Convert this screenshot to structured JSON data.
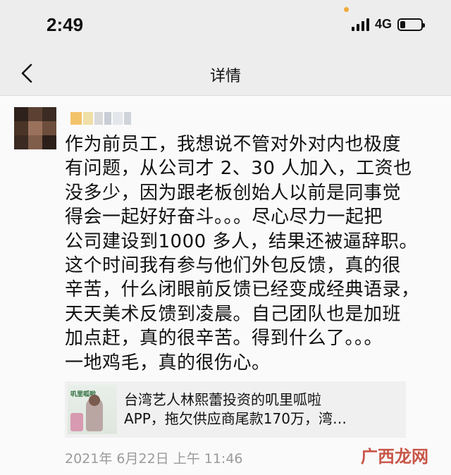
{
  "status_bar": {
    "time": "2:49",
    "network": "4G",
    "battery_level": 0.25
  },
  "nav": {
    "title": "详情",
    "back_icon": "chevron-left-icon"
  },
  "comment": {
    "lines": [
      "作为前员工，我想说不管对外对内也极度",
      "有问题，从公司才 2、30 人加入，工资也",
      "没多少，因为跟老板创始人以前是同事觉",
      "得会一起好好奋斗。。。尽心尽力一起把",
      "公司建设到1000 多人，结果还被逼辞职。",
      "这个时间我有参与他们外包反馈，真的很",
      "辛苦，什么闭眼前反馈已经变成经典语录，",
      "天天美术反馈到凌晨。自己团队也是加班",
      "加点赶，真的很辛苦。得到什么了。。。",
      "一地鸡毛，真的很伤心。"
    ]
  },
  "link_card": {
    "line1": "台湾艺人林熙蕾投资的叽里呱啦",
    "line2": "APP，拖欠供应商尾款170万，湾…",
    "thumb_text": "叽里呱啦"
  },
  "timestamp": "2021年 6月22日 上午 11:46",
  "watermark": "广西龙网"
}
